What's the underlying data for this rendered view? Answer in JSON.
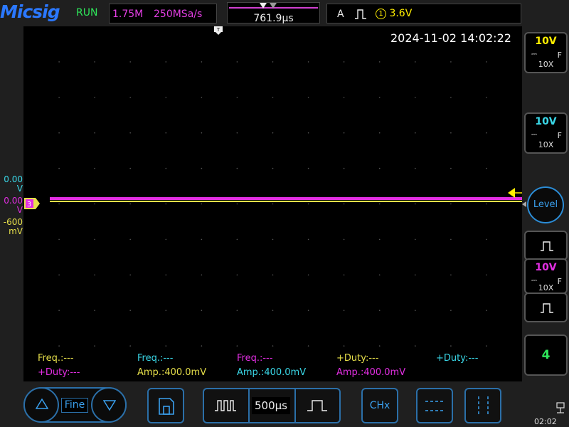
{
  "header": {
    "brand": "Micsig",
    "run_state": "RUN",
    "memory_depth": "1.75M",
    "sample_rate": "250MSa/s",
    "trigger_position": "761.9µs",
    "trigger_mode": "A",
    "trigger_level": "3.6V",
    "trigger_source_number": "1"
  },
  "screen": {
    "timestamp": "2024-11-02 14:02:22",
    "channel_offsets": [
      {
        "value": "0.00",
        "unit": "V",
        "color": "#3ad8e8"
      },
      {
        "value": "0.00",
        "unit": "V",
        "color": "#e22ee2"
      },
      {
        "value": "-600",
        "unit": "mV",
        "color": "#e6df4a"
      }
    ],
    "channel_marker_label": "3"
  },
  "measurements": [
    {
      "line1": "Freq.:---",
      "line2": "+Duty:---",
      "c1": "#e6df4a",
      "c2": "#e22ee2"
    },
    {
      "line1": "Freq.:---",
      "line2": "Amp.:400.0mV",
      "c1": "#3ad8e8",
      "c2": "#e6df4a"
    },
    {
      "line1": "Freq.:---",
      "line2": "Amp.:400.0mV",
      "c1": "#e22ee2",
      "c2": "#3ad8e8"
    },
    {
      "line1": "+Duty:---",
      "line2": "Amp.:400.0mV",
      "c1": "#e6df4a",
      "c2": "#e22ee2"
    },
    {
      "line1": "+Duty:---",
      "line2": "",
      "c1": "#3ad8e8",
      "c2": "#3ad8e8"
    }
  ],
  "right_panel": {
    "ch1": {
      "volts_div": "10V",
      "bandwidth": "F",
      "probe": "10X",
      "color": "#ffee00"
    },
    "ch2": {
      "volts_div": "10V",
      "bandwidth": "F",
      "probe": "10X",
      "color": "#3ad8e8"
    },
    "ch3": {
      "volts_div": "10V",
      "bandwidth": "F",
      "probe": "10X",
      "color": "#e22ee2"
    },
    "level_label": "Level",
    "ch4_label": "4"
  },
  "bottom_bar": {
    "fine_label": "Fine",
    "timebase": "500µs",
    "chx_label": "CHx",
    "clock": "02:02"
  },
  "colors": {
    "accent": "#2b78ff",
    "button_border": "#2b6fa8"
  }
}
